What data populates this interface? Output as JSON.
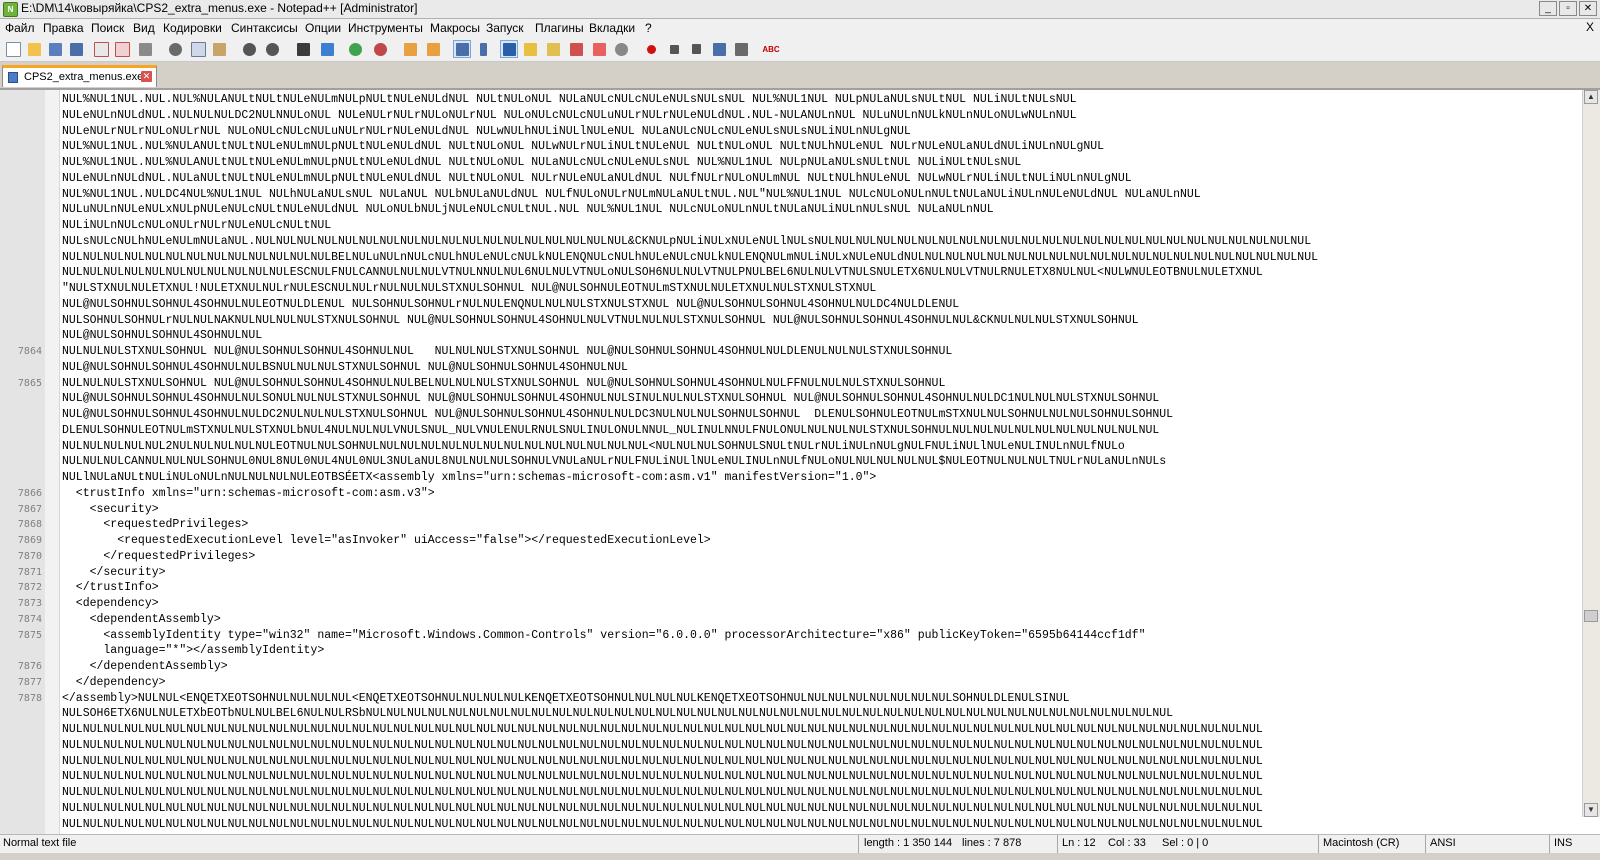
{
  "window": {
    "title": "E:\\DM\\14\\ковыряйка\\CPS2_extra_menus.exe - Notepad++ [Administrator]",
    "app_icon": "notepadpp-icon",
    "buttons": [
      "_",
      "▫",
      "✕"
    ]
  },
  "menu": {
    "items": [
      "Файл",
      "Правка",
      "Поиск",
      "Вид",
      "Кодировки",
      "Синтаксисы",
      "Опции",
      "Инструменты",
      "Макросы",
      "Запуск",
      "Плагины",
      "Вкладки",
      "?"
    ],
    "close_glyph": "X"
  },
  "toolbar": {
    "icons": [
      "new-file-icon",
      "open-file-icon",
      "save-icon",
      "save-all-icon",
      "close-icon",
      "close-all-icon",
      "print-icon",
      "cut-icon",
      "copy-icon",
      "paste-icon",
      "undo-icon",
      "redo-icon",
      "find-icon",
      "replace-icon",
      "zoom-in-icon",
      "zoom-out-icon",
      "sync-vertical-icon",
      "sync-horizontal-icon",
      "word-wrap-icon",
      "show-all-chars-icon",
      "indent-guide-icon",
      "udl-icon",
      "doc-map-icon",
      "function-list-icon",
      "folder-workspace-icon",
      "monitoring-icon",
      "record-macro-icon",
      "stop-macro-icon",
      "play-macro-icon",
      "run-macro-multiple-icon",
      "save-macro-icon",
      "spellcheck-icon"
    ],
    "spell_label": "ABC"
  },
  "tab": {
    "label": "CPS2_extra_menus.exe",
    "icon": "file-icon",
    "close_icon": "tab-close-icon"
  },
  "editor": {
    "lines": [
      {
        "num": "",
        "text": "NUL%NUL1NUL.NUL.NUL%NULANULtNULtNULeNULmNULpNULtNULeNULdNUL NULtNULoNUL NULaNULcNULcNULeNULsNULsNUL NUL%NUL1NUL NULpNULaNULsNULtNUL NULiNULtNULsNUL"
      },
      {
        "num": "",
        "text": "NULeNULnNULdNUL.NULNULNULDC2NULNNULoNUL NULeNULrNULrNULoNULrNUL NULoNULcNULcNULuNULrNULrNULeNULdNUL.NUL-NULANULnNUL NULuNULnNULkNULnNULoNULwNULnNUL"
      },
      {
        "num": "",
        "text": "NULeNULrNULrNULoNULrNUL NULoNULcNULcNULuNULrNULrNULeNULdNUL NULwNULhNULiNULlNULeNUL NULaNULcNULcNULeNULsNULsNULiNULnNULgNUL"
      },
      {
        "num": "",
        "text": "NUL%NUL1NUL.NUL%NULANULtNULtNULeNULmNULpNULtNULeNULdNUL NULtNULoNUL NULwNULrNULiNULtNULeNUL NULtNULoNUL NULtNULhNULeNUL NULrNULeNULaNULdNULiNULnNULgNUL"
      },
      {
        "num": "",
        "text": "NUL%NUL1NUL.NUL%NULANULtNULtNULeNULmNULpNULtNULeNULdNUL NULtNULoNUL NULaNULcNULcNULeNULsNUL NUL%NUL1NUL NULpNULaNULsNULtNUL NULiNULtNULsNUL"
      },
      {
        "num": "",
        "text": "NULeNULnNULdNUL.NULaNULtNULtNULeNULmNULpNULtNULeNULdNUL NULtNULoNUL NULrNULeNULaNULdNUL NULfNULrNULoNULmNUL NULtNULhNULeNUL NULwNULrNULiNULtNULiNULnNULgNUL"
      },
      {
        "num": "",
        "text": "NUL%NUL1NUL.NULDC4NUL%NUL1NUL NULhNULaNULsNUL NULaNUL NULbNULaNULdNUL NULfNULoNULrNULmNULaNULtNUL.NUL\"NUL%NUL1NUL NULcNULoNULnNULtNULaNULiNULnNULeNULdNUL NULaNULnNUL"
      },
      {
        "num": "",
        "text": "NULuNULnNULeNULxNULpNULeNULcNULtNULeNULdNUL NULoNULbNULjNULeNULcNULtNUL.NUL NUL%NUL1NUL NULcNULoNULnNULtNULaNULiNULnNULsNUL NULaNULnNUL"
      },
      {
        "num": "",
        "text": "NULiNULnNULcNULoNULrNULrNULeNULcNULtNUL"
      },
      {
        "num": "",
        "text": "NULsNULcNULhNULeNULmNULaNUL.NULNULNULNULNULNULNULNULNULNULNULNULNULNULNULNULNULNUL&CKNULpNULiNULxNULeNULlNULsNULNULNULNULNULNULNULNULNULNULNULNULNULNULNULNULNULNULNULNULNULNULNULNUL"
      },
      {
        "num": "",
        "text": "NULNULNULNULNULNULNULNULNULNULNULNULNULBELNULuNULnNULcNULhNULeNULcNULkNULENQNULcNULhNULeNULcNULkNULENQNULmNULiNULxNULeNULdNULNULNULNULNULNULNULNULNULNULNULNULNULNULNULNULNULNULNULNUL"
      },
      {
        "num": "",
        "text": "NULNULNULNULNULNULNULNULNULNULNULESCNULFNULCANNULNULNULVTNULNNULNUL6NULNULVTNULoNULSOH6NULNULVTNULPNULBEL6NULNULVTNULSNULETX6NULNULVTNULRNULETX8NULNUL<NULWNULEOTBNULNULETXNUL"
      },
      {
        "num": "",
        "text": "\"NULSTXNULNULETXNUL!NULETXNULNULrNULESCNULNULrNULNULNULSTXNULSOHNUL NUL@NULSOHNULEOTNULmSTXNULNULETXNULNULSTXNULSTXNUL"
      },
      {
        "num": "",
        "text": "NUL@NULSOHNULSOHNUL4SOHNULNULEOTNULDLENUL NULSOHNULSOHNULrNULNULENQNULNULNULSTXNULSTXNUL NUL@NULSOHNULSOHNUL4SOHNULNULDC4NULDLENUL"
      },
      {
        "num": "",
        "text": "NULSOHNULSOHNULrNULNULNAKNULNULNULNULSTXNULSOHNUL NUL@NULSOHNULSOHNUL4SOHNULNULVTNULNULNULSTXNULSOHNUL NUL@NULSOHNULSOHNUL4SOHNULNUL&CKNULNULNULSTXNULSOHNUL"
      },
      {
        "num": "",
        "text": "NUL@NULSOHNULSOHNUL4SOHNULNUL"
      },
      {
        "num": "7864",
        "text": "NULNULNULSTXNULSOHNUL NUL@NULSOHNULSOHNUL4SOHNULNUL   NULNULNULSTXNULSOHNUL NUL@NULSOHNULSOHNUL4SOHNULNULDLENULNULNULSTXNULSOHNUL"
      },
      {
        "num": "",
        "text": "NUL@NULSOHNULSOHNUL4SOHNULNULBSNULNULNULSTXNULSOHNUL NUL@NULSOHNULSOHNUL4SOHNULNUL"
      },
      {
        "num": "7865",
        "text": "NULNULNULSTXNULSOHNUL NUL@NULSOHNULSOHNUL4SOHNULNULBELNULNULNULSTXNULSOHNUL NUL@NULSOHNULSOHNUL4SOHNULNULFFNULNULNULSTXNULSOHNUL"
      },
      {
        "num": "",
        "text": "NUL@NULSOHNULSOHNUL4SOHNULNULSONULNULNULSTXNULSOHNUL NUL@NULSOHNULSOHNUL4SOHNULNULSINULNULNULSTXNULSOHNUL NUL@NULSOHNULSOHNUL4SOHNULNULDC1NULNULNULSTXNULSOHNUL"
      },
      {
        "num": "",
        "text": "NUL@NULSOHNULSOHNUL4SOHNULNULDC2NULNULNULSTXNULSOHNUL NUL@NULSOHNULSOHNUL4SOHNULNULDC3NULNULNULSOHNULSOHNUL  DLENULSOHNULEOTNULmSTXNULNULSOHNULNULNULSOHNULSOHNUL"
      },
      {
        "num": "",
        "text": "DLENULSOHNULEOTNULmSTXNULNULSTXNULbNUL4NULNULNULVNULSNUL_NULVNULENULRNULSNULINULONULNNUL_NULINULNNULFNULONULNULNULNULSTXNULSOHNULNULNULNULNULNULNULNULNULNULNUL"
      },
      {
        "num": "",
        "text": "NULNULNULNULNUL2NULNULNULNULNULEOTNULNULSOHNULNULNULNULNULNULNULNULNULNULNULNULNULNUL<NULNULNULSOHNULSNULtNULrNULiNULnNULgNULFNULiNULlNULeNULINULnNULfNULo"
      },
      {
        "num": "",
        "text": "NULNULNULCANNULNULNULSOHNUL0NUL8NUL0NUL4NUL0NUL3NULaNUL8NULNULNULSOHNULVNULaNULrNULFNULiNULlNULeNULINULnNULfNULoNULNULNULNULNUL$NULEOTNULNULNULTNULrNULaNULnNULs"
      },
      {
        "num": "",
        "text": "NULlNULaNULtNULiNULoNULnNULNULNULNULEOTBSÉETX<assembly xmlns=\"urn:schemas-microsoft-com:asm.v1\" manifestVersion=\"1.0\">"
      },
      {
        "num": "7866",
        "text": "  <trustInfo xmlns=\"urn:schemas-microsoft-com:asm.v3\">"
      },
      {
        "num": "7867",
        "text": "    <security>"
      },
      {
        "num": "7868",
        "text": "      <requestedPrivileges>"
      },
      {
        "num": "7869",
        "text": "        <requestedExecutionLevel level=\"asInvoker\" uiAccess=\"false\"></requestedExecutionLevel>"
      },
      {
        "num": "7870",
        "text": "      </requestedPrivileges>"
      },
      {
        "num": "7871",
        "text": "    </security>"
      },
      {
        "num": "7872",
        "text": "  </trustInfo>"
      },
      {
        "num": "7873",
        "text": "  <dependency>"
      },
      {
        "num": "7874",
        "text": "    <dependentAssembly>"
      },
      {
        "num": "7875",
        "text": "      <assemblyIdentity type=\"win32\" name=\"Microsoft.Windows.Common-Controls\" version=\"6.0.0.0\" processorArchitecture=\"x86\" publicKeyToken=\"6595b64144ccf1df\""
      },
      {
        "num": "",
        "text": "      language=\"*\"></assemblyIdentity>"
      },
      {
        "num": "7876",
        "text": "    </dependentAssembly>"
      },
      {
        "num": "7877",
        "text": "  </dependency>"
      },
      {
        "num": "7878",
        "text": "</assembly>NULNUL<ENQETXEOTSOHNULNULNULNUL<ENQETXEOTSOHNULNULNULNULKENQETXEOTSOHNULNULNULNULKENQETXEOTSOHNULNULNULNULNULNULNULNULSOHNULDLENULSINUL"
      },
      {
        "num": "",
        "text": "NULSOH6ETX6NULNULETXbEOTbNULNULBEL6NULNULRSbNULNULNULNULNULNULNULNULNULNULNULNULNULNULNULNULNULNULNULNULNULNULNULNULNULNULNULNULNULNULNULNULNULNULNULNULNULNULNUL"
      },
      {
        "num": "",
        "text": "NULNULNULNULNULNULNULNULNULNULNULNULNULNULNULNULNULNULNULNULNULNULNULNULNULNULNULNULNULNULNULNULNULNULNULNULNULNULNULNULNULNULNULNULNULNULNULNULNULNULNULNULNULNULNULNULNULNUL"
      },
      {
        "num": "",
        "text": "NULNULNULNULNULNULNULNULNULNULNULNULNULNULNULNULNULNULNULNULNULNULNULNULNULNULNULNULNULNULNULNULNULNULNULNULNULNULNULNULNULNULNULNULNULNULNULNULNULNULNULNULNULNULNULNULNULNUL"
      },
      {
        "num": "",
        "text": "NULNULNULNULNULNULNULNULNULNULNULNULNULNULNULNULNULNULNULNULNULNULNULNULNULNULNULNULNULNULNULNULNULNULNULNULNULNULNULNULNULNULNULNULNULNULNULNULNULNULNULNULNULNULNULNULNULNUL"
      },
      {
        "num": "",
        "text": "NULNULNULNULNULNULNULNULNULNULNULNULNULNULNULNULNULNULNULNULNULNULNULNULNULNULNULNULNULNULNULNULNULNULNULNULNULNULNULNULNULNULNULNULNULNULNULNULNULNULNULNULNULNULNULNULNULNUL"
      },
      {
        "num": "",
        "text": "NULNULNULNULNULNULNULNULNULNULNULNULNULNULNULNULNULNULNULNULNULNULNULNULNULNULNULNULNULNULNULNULNULNULNULNULNULNULNULNULNULNULNULNULNULNULNULNULNULNULNULNULNULNULNULNULNULNUL"
      },
      {
        "num": "",
        "text": "NULNULNULNULNULNULNULNULNULNULNULNULNULNULNULNULNULNULNULNULNULNULNULNULNULNULNULNULNULNULNULNULNULNULNULNULNULNULNULNULNULNULNULNULNULNULNULNULNULNULNULNULNULNULNULNULNULNUL"
      },
      {
        "num": "",
        "text": "NULNULNULNULNULNULNULNULNULNULNULNULNULNULNULNULNULNULNULNULNULNULNULNULNULNULNULNULNULNULNULNULNULNULNULNULNULNULNULNULNULNULNULNULNULNULNULNULNULNULNULNULNULNULNULNULNULNUL"
      },
      {
        "num": "",
        "text": "NULNULNULNULNULNULNULNULNULNULNULNULNULNULNULNULNULNULNULNULNULNULNULNULNULNULNULNULNULNULNULNULNULNULNULNULNULNULNULNULNULNULNULNULNULNULNULNULNULNULNULNULNUL"
      }
    ]
  },
  "statusbar": {
    "file_type": "Normal text file",
    "length": "length : 1 350 144",
    "lines": "lines : 7 878",
    "ln": "Ln : 12",
    "col": "Col : 33",
    "sel": "Sel : 0 | 0",
    "eol": "Macintosh (CR)",
    "encoding": "ANSI",
    "mode": "INS"
  },
  "colors": {
    "title_bg": "#eaeaea",
    "tab_accent": "#f5a623",
    "control_char_bg": "#000000",
    "control_char_fg": "#ffffff",
    "line_number": "#808080"
  }
}
